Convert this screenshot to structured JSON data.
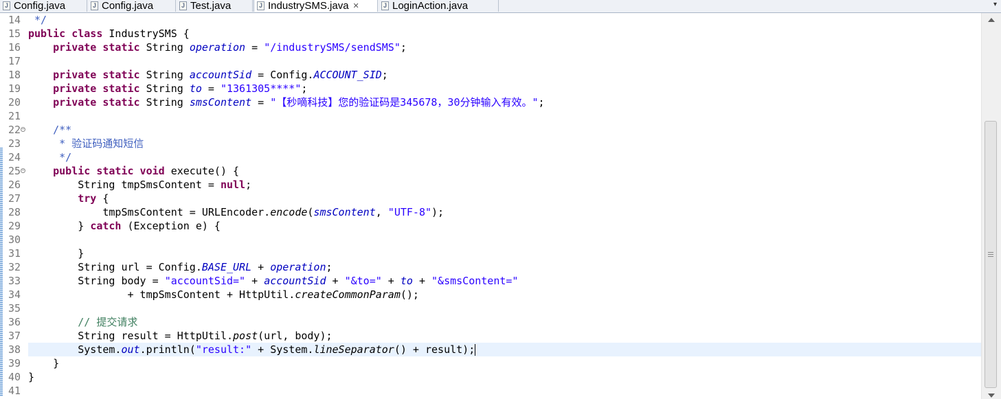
{
  "tabs": [
    {
      "label": "Config.java",
      "active": false
    },
    {
      "label": "Config.java",
      "active": false
    },
    {
      "label": "Test.java",
      "active": false
    },
    {
      "label": "IndustrySMS.java",
      "active": true
    },
    {
      "label": "LoginAction.java",
      "active": false
    }
  ],
  "tab_icon": "java-file-icon",
  "tab_close_glyph": "✕",
  "tab_overflow_glyph": "▾",
  "editor": {
    "current_line": 38,
    "lines": [
      {
        "num": "14",
        "fold": false,
        "tokens": [
          {
            "t": " */",
            "c": "doc"
          }
        ]
      },
      {
        "num": "15",
        "fold": false,
        "tokens": [
          {
            "t": "public class",
            "c": "kw"
          },
          {
            "t": " IndustrySMS {",
            "c": ""
          }
        ]
      },
      {
        "num": "16",
        "fold": false,
        "tokens": [
          {
            "t": "    ",
            "c": ""
          },
          {
            "t": "private static",
            "c": "kw"
          },
          {
            "t": " String ",
            "c": ""
          },
          {
            "t": "operation",
            "c": "field"
          },
          {
            "t": " = ",
            "c": ""
          },
          {
            "t": "\"/industrySMS/sendSMS\"",
            "c": "str"
          },
          {
            "t": ";",
            "c": ""
          }
        ]
      },
      {
        "num": "17",
        "fold": false,
        "tokens": []
      },
      {
        "num": "18",
        "fold": false,
        "tokens": [
          {
            "t": "    ",
            "c": ""
          },
          {
            "t": "private static",
            "c": "kw"
          },
          {
            "t": " String ",
            "c": ""
          },
          {
            "t": "accountSid",
            "c": "field"
          },
          {
            "t": " = Config.",
            "c": ""
          },
          {
            "t": "ACCOUNT_SID",
            "c": "field"
          },
          {
            "t": ";",
            "c": ""
          }
        ]
      },
      {
        "num": "19",
        "fold": false,
        "tokens": [
          {
            "t": "    ",
            "c": ""
          },
          {
            "t": "private static",
            "c": "kw"
          },
          {
            "t": " String ",
            "c": ""
          },
          {
            "t": "to",
            "c": "field"
          },
          {
            "t": " = ",
            "c": ""
          },
          {
            "t": "\"1361305****\"",
            "c": "str"
          },
          {
            "t": ";",
            "c": ""
          }
        ]
      },
      {
        "num": "20",
        "fold": false,
        "tokens": [
          {
            "t": "    ",
            "c": ""
          },
          {
            "t": "private static",
            "c": "kw"
          },
          {
            "t": " String ",
            "c": ""
          },
          {
            "t": "smsContent",
            "c": "field"
          },
          {
            "t": " = ",
            "c": ""
          },
          {
            "t": "\"【秒嘀科技】您的验证码是345678，30分钟输入有效。\"",
            "c": "str"
          },
          {
            "t": ";",
            "c": ""
          }
        ]
      },
      {
        "num": "21",
        "fold": false,
        "tokens": []
      },
      {
        "num": "22",
        "fold": true,
        "tokens": [
          {
            "t": "    /**",
            "c": "doc"
          }
        ]
      },
      {
        "num": "23",
        "fold": false,
        "tokens": [
          {
            "t": "     * 验证码通知短信",
            "c": "doc"
          }
        ]
      },
      {
        "num": "24",
        "fold": false,
        "tokens": [
          {
            "t": "     */",
            "c": "doc"
          }
        ]
      },
      {
        "num": "25",
        "fold": true,
        "tokens": [
          {
            "t": "    ",
            "c": ""
          },
          {
            "t": "public static void",
            "c": "kw"
          },
          {
            "t": " execute() {",
            "c": ""
          }
        ]
      },
      {
        "num": "26",
        "fold": false,
        "tokens": [
          {
            "t": "        String tmpSmsContent = ",
            "c": ""
          },
          {
            "t": "null",
            "c": "kw"
          },
          {
            "t": ";",
            "c": ""
          }
        ]
      },
      {
        "num": "27",
        "fold": false,
        "tokens": [
          {
            "t": "        ",
            "c": ""
          },
          {
            "t": "try",
            "c": "kw"
          },
          {
            "t": " {",
            "c": ""
          }
        ]
      },
      {
        "num": "28",
        "fold": false,
        "tokens": [
          {
            "t": "            tmpSmsContent = URLEncoder.",
            "c": ""
          },
          {
            "t": "encode",
            "c": "static-m"
          },
          {
            "t": "(",
            "c": ""
          },
          {
            "t": "smsContent",
            "c": "field"
          },
          {
            "t": ", ",
            "c": ""
          },
          {
            "t": "\"UTF-8\"",
            "c": "str"
          },
          {
            "t": ");",
            "c": ""
          }
        ]
      },
      {
        "num": "29",
        "fold": false,
        "tokens": [
          {
            "t": "        } ",
            "c": ""
          },
          {
            "t": "catch",
            "c": "kw"
          },
          {
            "t": " (Exception e) {",
            "c": ""
          }
        ]
      },
      {
        "num": "30",
        "fold": false,
        "tokens": []
      },
      {
        "num": "31",
        "fold": false,
        "tokens": [
          {
            "t": "        }",
            "c": ""
          }
        ]
      },
      {
        "num": "32",
        "fold": false,
        "tokens": [
          {
            "t": "        String url = Config.",
            "c": ""
          },
          {
            "t": "BASE_URL",
            "c": "field"
          },
          {
            "t": " + ",
            "c": ""
          },
          {
            "t": "operation",
            "c": "field"
          },
          {
            "t": ";",
            "c": ""
          }
        ]
      },
      {
        "num": "33",
        "fold": false,
        "tokens": [
          {
            "t": "        String body = ",
            "c": ""
          },
          {
            "t": "\"accountSid=\"",
            "c": "str"
          },
          {
            "t": " + ",
            "c": ""
          },
          {
            "t": "accountSid",
            "c": "field"
          },
          {
            "t": " + ",
            "c": ""
          },
          {
            "t": "\"&to=\"",
            "c": "str"
          },
          {
            "t": " + ",
            "c": ""
          },
          {
            "t": "to",
            "c": "field"
          },
          {
            "t": " + ",
            "c": ""
          },
          {
            "t": "\"&smsContent=\"",
            "c": "str"
          }
        ]
      },
      {
        "num": "34",
        "fold": false,
        "tokens": [
          {
            "t": "                + tmpSmsContent + HttpUtil.",
            "c": ""
          },
          {
            "t": "createCommonParam",
            "c": "static-m"
          },
          {
            "t": "();",
            "c": ""
          }
        ]
      },
      {
        "num": "35",
        "fold": false,
        "tokens": []
      },
      {
        "num": "36",
        "fold": false,
        "tokens": [
          {
            "t": "        // 提交请求",
            "c": "cmt"
          }
        ]
      },
      {
        "num": "37",
        "fold": false,
        "tokens": [
          {
            "t": "        String result = HttpUtil.",
            "c": ""
          },
          {
            "t": "post",
            "c": "static-m"
          },
          {
            "t": "(url, body);",
            "c": ""
          }
        ]
      },
      {
        "num": "38",
        "fold": false,
        "tokens": [
          {
            "t": "        System.",
            "c": ""
          },
          {
            "t": "out",
            "c": "field"
          },
          {
            "t": ".println(",
            "c": ""
          },
          {
            "t": "\"result:\"",
            "c": "str"
          },
          {
            "t": " + System.",
            "c": ""
          },
          {
            "t": "lineSeparator",
            "c": "static-m"
          },
          {
            "t": "() + result);",
            "c": ""
          }
        ]
      },
      {
        "num": "39",
        "fold": false,
        "tokens": [
          {
            "t": "    }",
            "c": ""
          }
        ]
      },
      {
        "num": "40",
        "fold": false,
        "tokens": [
          {
            "t": "}",
            "c": ""
          }
        ]
      },
      {
        "num": "41",
        "fold": false,
        "tokens": []
      }
    ]
  },
  "scrollbar": {
    "up_icon": "scroll-up-arrow-icon",
    "down_icon": "scroll-down-arrow-icon"
  }
}
